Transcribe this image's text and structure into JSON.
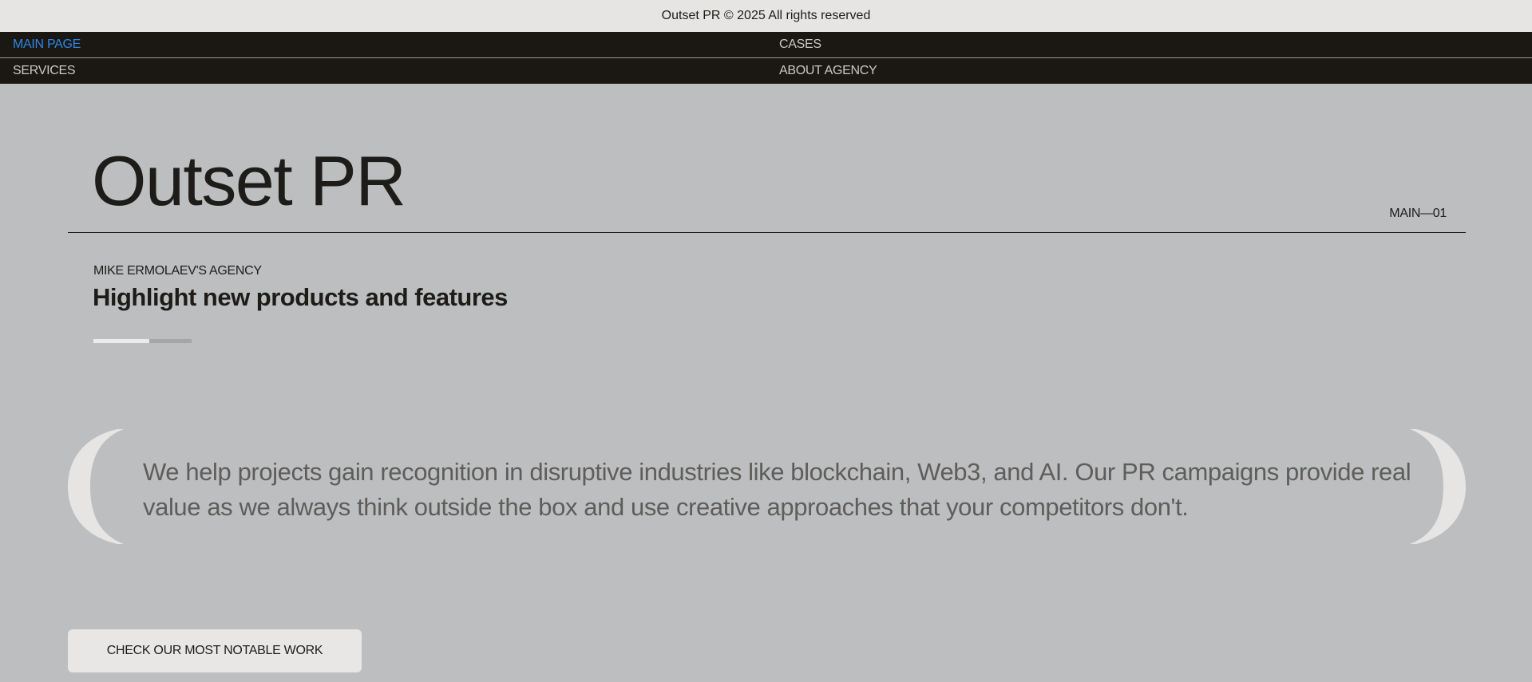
{
  "topbar": {
    "copyright": "Outset PR © 2025 All rights reserved"
  },
  "nav": {
    "items": [
      {
        "label": "MAIN PAGE",
        "active": true
      },
      {
        "label": "CASES",
        "active": false
      },
      {
        "label": "SERVICES",
        "active": false
      },
      {
        "label": "ABOUT AGENCY",
        "active": false
      }
    ]
  },
  "hero": {
    "title": "Outset PR",
    "section_index": "MAIN—01",
    "agency_label": "MIKE ERMOLAEV'S AGENCY",
    "subtitle": "Highlight new products and features",
    "slider_progress": 0.57
  },
  "quote": {
    "text": "We help projects gain recognition in disruptive industries like blockchain, Web3, and AI. Our PR campaigns provide real value as we always think outside the box and use creative approaches that your competitors don't."
  },
  "cta": {
    "label": "CHECK OUR MOST NOTABLE WORK"
  },
  "colors": {
    "background": "#bdbebf",
    "nav_bg": "#1b1813",
    "accent": "#2d86e6",
    "bracket": "#e6e5e3"
  }
}
